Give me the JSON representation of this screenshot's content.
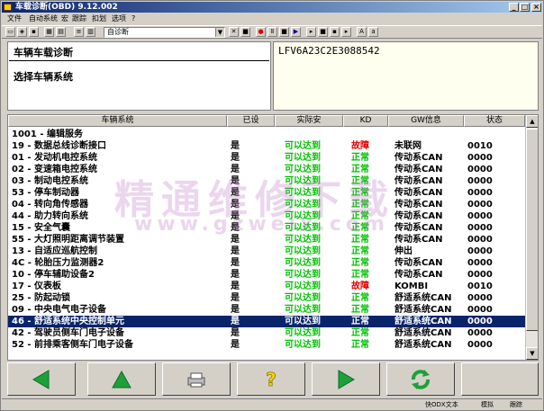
{
  "window": {
    "title": "车载诊断(OBD) 9.12.002"
  },
  "menu": [
    "文件",
    "自动系统",
    "宏",
    "跟踪",
    "扣划",
    "选项",
    "?"
  ],
  "toolbar": {
    "combo_value": "自诊断"
  },
  "info": {
    "title": "车辆车载诊断",
    "subtitle": "选择车辆系统",
    "vin": "LFV6A23C2E3088542"
  },
  "table": {
    "headers": [
      "车辆系统",
      "已设",
      "实际安",
      "KD",
      "GW信息",
      "状态"
    ],
    "rows": [
      {
        "system": "1001 - 编辑服务",
        "set": "",
        "actual": "",
        "kd": "",
        "gw": "",
        "status": ""
      },
      {
        "system": "19 - 数据总线诊断接口",
        "set": "是",
        "actual": "可以达到",
        "kd": "故障",
        "gw": "未联网",
        "status": "0010"
      },
      {
        "system": "01 - 发动机电控系统",
        "set": "是",
        "actual": "可以达到",
        "kd": "正常",
        "gw": "传动系CAN",
        "status": "0000"
      },
      {
        "system": "02 - 变速箱电控系统",
        "set": "是",
        "actual": "可以达到",
        "kd": "正常",
        "gw": "传动系CAN",
        "status": "0000"
      },
      {
        "system": "03 - 制动电控系统",
        "set": "是",
        "actual": "可以达到",
        "kd": "正常",
        "gw": "传动系CAN",
        "status": "0000"
      },
      {
        "system": "53 - 停车制动器",
        "set": "是",
        "actual": "可以达到",
        "kd": "正常",
        "gw": "传动系CAN",
        "status": "0000"
      },
      {
        "system": "04 - 转向角传感器",
        "set": "是",
        "actual": "可以达到",
        "kd": "正常",
        "gw": "传动系CAN",
        "status": "0000"
      },
      {
        "system": "44 - 助力转向系统",
        "set": "是",
        "actual": "可以达到",
        "kd": "正常",
        "gw": "传动系CAN",
        "status": "0000"
      },
      {
        "system": "15 - 安全气囊",
        "set": "是",
        "actual": "可以达到",
        "kd": "正常",
        "gw": "传动系CAN",
        "status": "0000"
      },
      {
        "system": "55 - 大灯照明距离调节装置",
        "set": "是",
        "actual": "可以达到",
        "kd": "正常",
        "gw": "传动系CAN",
        "status": "0000"
      },
      {
        "system": "13 - 自适应巡航控制",
        "set": "是",
        "actual": "可以达到",
        "kd": "正常",
        "gw": "伸出",
        "status": "0000"
      },
      {
        "system": "4C - 轮胎压力监测器2",
        "set": "是",
        "actual": "可以达到",
        "kd": "正常",
        "gw": "传动系CAN",
        "status": "0000"
      },
      {
        "system": "10 - 停车辅助设备2",
        "set": "是",
        "actual": "可以达到",
        "kd": "正常",
        "gw": "传动系CAN",
        "status": "0000"
      },
      {
        "system": "17 - 仪表板",
        "set": "是",
        "actual": "可以达到",
        "kd": "故障",
        "gw": "KOMBI",
        "status": "0010"
      },
      {
        "system": "25 - 防起动锁",
        "set": "是",
        "actual": "可以达到",
        "kd": "正常",
        "gw": "舒适系统CAN",
        "status": "0000"
      },
      {
        "system": "09 - 中央电气电子设备",
        "set": "是",
        "actual": "可以达到",
        "kd": "正常",
        "gw": "舒适系统CAN",
        "status": "0000"
      },
      {
        "system": "46 - 舒适系统中央控制单元",
        "set": "是",
        "actual": "可以达到",
        "kd": "正常",
        "gw": "舒适系统CAN",
        "status": "0000"
      },
      {
        "system": "42 - 驾驶员侧车门电子设备",
        "set": "是",
        "actual": "可以达到",
        "kd": "正常",
        "gw": "舒适系统CAN",
        "status": "0000"
      },
      {
        "system": "52 - 前排乘客侧车门电子设备",
        "set": "是",
        "actual": "可以达到",
        "kd": "正常",
        "gw": "舒适系统CAN",
        "status": "0000"
      }
    ],
    "selected_row": 16
  },
  "watermark": {
    "text": "精通维修下载",
    "url": "www.gzweix.com"
  },
  "icons": {
    "back": "arrow-left-icon",
    "up": "arrow-up-icon",
    "print": "printer-icon",
    "help": "help-icon",
    "forward": "arrow-right-icon",
    "refresh": "refresh-icon"
  },
  "colors": {
    "ok": "#00c000",
    "fault": "#e00000",
    "selection": "#0a246a",
    "button_green": "#1ca13a"
  },
  "status": {
    "text1": "快ODX文本",
    "text2": "模拟",
    "text3": "跟踪"
  }
}
